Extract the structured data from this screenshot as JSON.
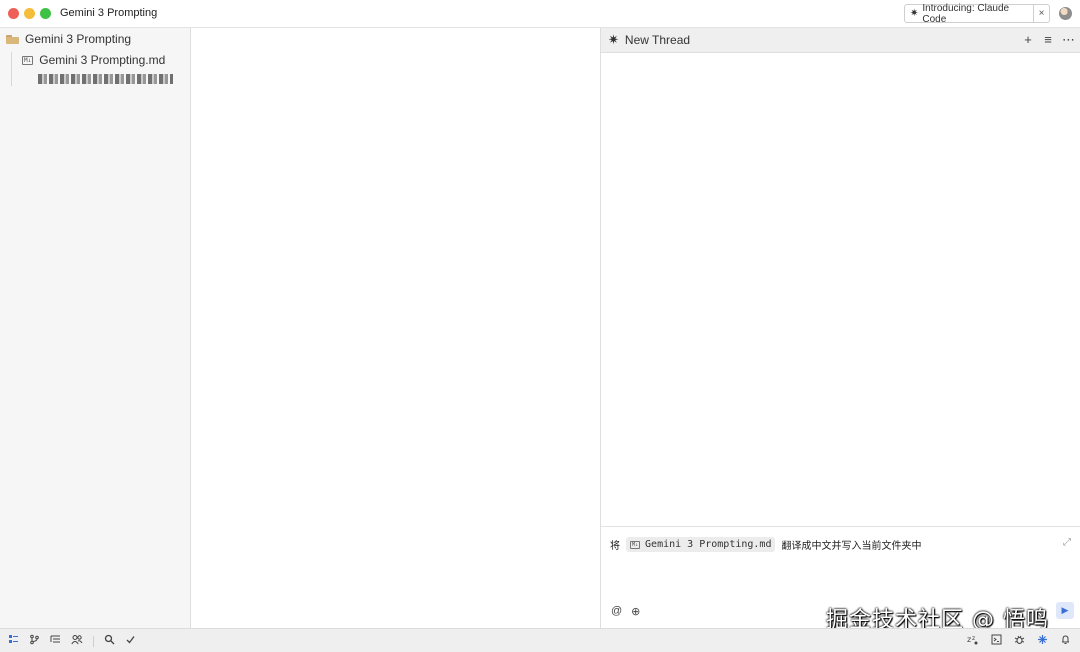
{
  "window": {
    "title": "Gemini 3 Prompting"
  },
  "promo": {
    "label": "Introducing: Claude Code",
    "close": "×"
  },
  "sidebar": {
    "folder": "Gemini 3 Prompting",
    "items": [
      {
        "label": "Gemini 3 Prompting.md",
        "icon": "markdown-file-icon"
      }
    ]
  },
  "agent": {
    "header_title": "New Thread",
    "composer": {
      "prefix": "将",
      "file_chip": "Gemini 3 Prompting.md",
      "suffix": "翻译成中文并写入当前文件夹中"
    }
  },
  "watermark": {
    "text": "掘金技术社区 @ 悟鸣"
  },
  "icons": {
    "md_badge": "M↓",
    "spark": "✷",
    "add": "+",
    "history": "≡",
    "more": "⋯",
    "expand": "⤢",
    "mention": "@",
    "context": "⊕",
    "send": "▶"
  },
  "colors": {
    "accent": "#3a6fd8",
    "close": "#ee5f57",
    "minimize": "#f4bd3a",
    "maximize": "#3fc145"
  }
}
